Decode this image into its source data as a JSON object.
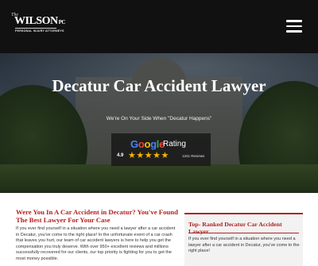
{
  "header": {
    "logo": {
      "prefix": "The",
      "name": "WILSON",
      "suffix": "PC",
      "tagline": "PERSONAL INJURY ATTORNEYS"
    },
    "menu_icon": "hamburger-menu-icon"
  },
  "hero": {
    "title": "Decatur Car Accident Lawyer",
    "subtitle": "We're On Your Side When \"Decatur Happens\"",
    "rating": {
      "brand": "Google",
      "label": "Rating",
      "score": "4.9",
      "stars": 5,
      "reviews": "1241 Reviews"
    }
  },
  "main": {
    "heading": "Were You In A Car Accident in Decatur? You've Found The Best Lawyer For Your Case",
    "paragraph": "If you ever find yourself in a situation where you need a lawyer after a car accident in Decatur, you've come to the right place! In the unfortunate event of a car crash that leaves you hurt, our team of car accident lawyers is here to help you get the compensation you truly deserve. With over 950+ excellent reviews and millions successfully recovered for our clients, our top priority is fighting for you to get the most money possible."
  },
  "sidebar": {
    "heading": "Top- Ranked Decatur Car Accident Lawyer",
    "paragraph": "If you ever find yourself in a situation where you need a lawyer after a car accident in Decatur, you've come to the right place!"
  },
  "colors": {
    "accent": "#b22222",
    "header_bg": "#111111",
    "star": "#f6b400",
    "google_blue": "#4285f4",
    "google_red": "#ea4335",
    "google_yellow": "#fbbc05",
    "google_green": "#34a853"
  }
}
